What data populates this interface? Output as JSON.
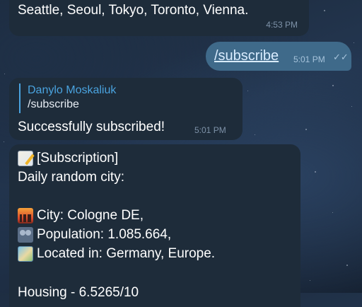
{
  "messages": [
    {
      "text": "Seattle, Seoul, Tokyo, Toronto, Vienna.",
      "time": "4:53 PM"
    },
    {
      "text": "/subscribe",
      "time": "5:01 PM",
      "status_icon": "double-check-icon"
    },
    {
      "reply_to": {
        "author": "Danylo Moskaliuk",
        "text": "/subscribe"
      },
      "text": "Successfully subscribed!",
      "time": "5:01 PM"
    },
    {
      "lines": [
        {
          "icon": "memo-icon",
          "text": "[Subscription]"
        },
        {
          "icon": "",
          "text": "Daily random city:"
        },
        {
          "icon": "",
          "text": ""
        },
        {
          "icon": "cityscape-icon",
          "text": "City: Cologne DE,"
        },
        {
          "icon": "people-icon",
          "text": "Population: 1.085.664,"
        },
        {
          "icon": "world-map-icon",
          "text": "Located in: Germany, Europe."
        },
        {
          "icon": "",
          "text": ""
        },
        {
          "icon": "",
          "text": "Housing - 6.5265/10"
        }
      ]
    }
  ]
}
